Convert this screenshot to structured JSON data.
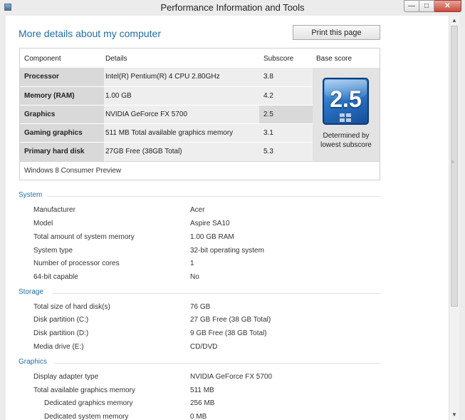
{
  "window": {
    "title": "Performance Information and Tools",
    "controls": {
      "minimize": "—",
      "maximize": "□",
      "close": "✕"
    }
  },
  "header": {
    "heading": "More details about my computer",
    "print_button": "Print this page"
  },
  "score_table": {
    "headers": {
      "component": "Component",
      "details": "Details",
      "subscore": "Subscore",
      "base_score": "Base score"
    },
    "rows": [
      {
        "component": "Processor",
        "details": "Intel(R) Pentium(R) 4 CPU 2.80GHz",
        "subscore": "3.8"
      },
      {
        "component": "Memory (RAM)",
        "details": "1.00 GB",
        "subscore": "4.2"
      },
      {
        "component": "Graphics",
        "details": "NVIDIA GeForce FX 5700",
        "subscore": "2.5"
      },
      {
        "component": "Gaming graphics",
        "details": "511 MB Total available graphics memory",
        "subscore": "3.1"
      },
      {
        "component": "Primary hard disk",
        "details": "27GB Free (38GB Total)",
        "subscore": "5.3"
      }
    ],
    "base_score": "2.5",
    "base_caption_line1": "Determined by",
    "base_caption_line2": "lowest subscore",
    "edition": "Windows 8 Consumer Preview"
  },
  "sections": {
    "system": {
      "title": "System",
      "items": [
        {
          "label": "Manufacturer",
          "value": "Acer"
        },
        {
          "label": "Model",
          "value": "Aspire SA10"
        },
        {
          "label": "Total amount of system memory",
          "value": "1.00 GB RAM"
        },
        {
          "label": "System type",
          "value": "32-bit operating system"
        },
        {
          "label": "Number of processor cores",
          "value": "1"
        },
        {
          "label": "64-bit capable",
          "value": "No"
        }
      ]
    },
    "storage": {
      "title": "Storage",
      "items": [
        {
          "label": "Total size of hard disk(s)",
          "value": "76 GB"
        },
        {
          "label": "Disk partition (C:)",
          "value": "27 GB Free (38 GB Total)"
        },
        {
          "label": "Disk partition (D:)",
          "value": "9 GB Free (38 GB Total)"
        },
        {
          "label": "Media drive (E:)",
          "value": "CD/DVD"
        }
      ]
    },
    "graphics": {
      "title": "Graphics",
      "items": [
        {
          "label": "Display adapter type",
          "value": "NVIDIA GeForce FX 5700"
        },
        {
          "label": "Total available graphics memory",
          "value": "511 MB"
        },
        {
          "label": "Dedicated graphics memory",
          "value": "256 MB"
        },
        {
          "label": "Dedicated system memory",
          "value": "0 MB"
        }
      ]
    }
  },
  "colors": {
    "accent": "#1e6ea8",
    "score_tile": "#2a75c5",
    "close_button": "#c84b3c"
  },
  "icons": {
    "app": "performance-app-icon",
    "score": "windows-logo-icon"
  }
}
